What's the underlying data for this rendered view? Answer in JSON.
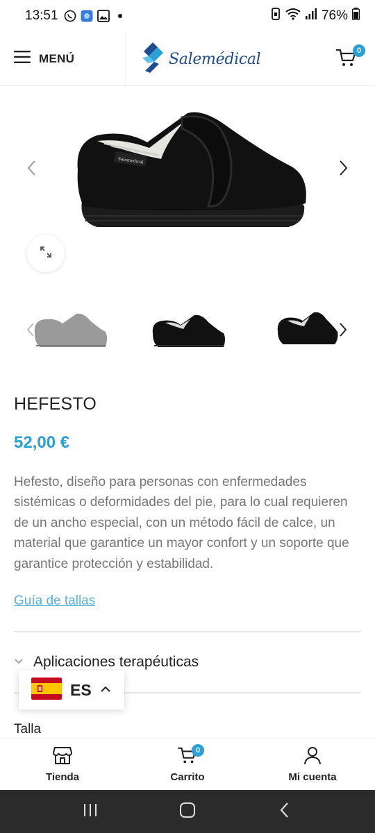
{
  "status_bar": {
    "time": "13:51",
    "battery": "76%",
    "left_icons": [
      "whatsapp-icon",
      "app-icon",
      "gallery-icon",
      "dot-icon"
    ],
    "right_icons": [
      "vibrate-icon",
      "wifi-icon",
      "signal-icon",
      "battery-icon"
    ]
  },
  "header": {
    "menu_label": "MENÚ",
    "logo_text": "Salemédical",
    "cart_count": "0",
    "brand_color": "#1e4d91",
    "accent_color": "#2a9fd8"
  },
  "gallery": {
    "main_image": "black-velcro-slipper-shoe",
    "thumbnails": [
      "grey-velcro-slipper",
      "black-velcro-slipper-side",
      "black-velcro-slipper-angle"
    ]
  },
  "product": {
    "title": "HEFESTO",
    "price": "52,00 €",
    "description": "Hefesto, diseño para personas con enfermedades sistémicas o deformidades del pie, para lo cual requieren de un ancho especial, con un método fácil de calce, un material que garantice un mayor confort y un soporte que garantice protección y estabilidad.",
    "size_guide_label": "Guía de tallas",
    "accordion_label": "Aplicaciones terapéuticas",
    "size_label": "Talla"
  },
  "language": {
    "code": "ES",
    "flag": "spain-flag"
  },
  "bottom_nav": {
    "items": [
      {
        "label": "Tienda",
        "icon": "store-icon"
      },
      {
        "label": "Carrito",
        "icon": "cart-icon",
        "badge": "0"
      },
      {
        "label": "Mi cuenta",
        "icon": "user-icon"
      }
    ]
  }
}
